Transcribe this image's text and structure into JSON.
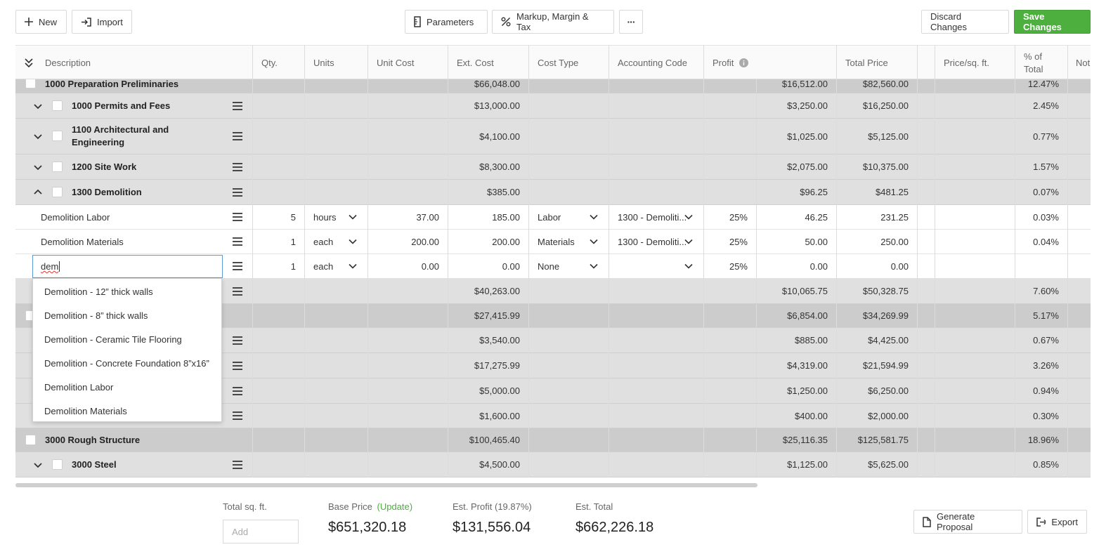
{
  "toolbar": {
    "new_label": "New",
    "import_label": "Import",
    "parameters_label": "Parameters",
    "markup_label": "Markup, Margin & Tax",
    "more_label": "···",
    "discard_label": "Discard Changes",
    "save_label": "Save Changes"
  },
  "columns": {
    "description": "Description",
    "qty": "Qty.",
    "units": "Units",
    "unit_cost": "Unit Cost",
    "ext_cost": "Ext. Cost",
    "cost_type": "Cost Type",
    "accounting_code": "Accounting Code",
    "profit": "Profit",
    "total_price": "Total Price",
    "price_sqft": "Price/sq. ft.",
    "pct_total_1": "% of",
    "pct_total_2": "Total",
    "notes": "Not"
  },
  "rows": [
    {
      "type": "section",
      "name": "1000 Preparation Preliminaries",
      "ext_cost": "$66,048.00",
      "profit": "$16,512.00",
      "total": "$82,560.00",
      "pct": "12.47%"
    },
    {
      "type": "group",
      "name": "1000 Permits and Fees",
      "ext_cost": "$13,000.00",
      "profit": "$3,250.00",
      "total": "$16,250.00",
      "pct": "2.45%"
    },
    {
      "type": "group",
      "name_line1": "1100 Architectural and",
      "name_line2": "Engineering",
      "ext_cost": "$4,100.00",
      "profit": "$1,025.00",
      "total": "$5,125.00",
      "pct": "0.77%"
    },
    {
      "type": "group",
      "name": "1200 Site Work",
      "ext_cost": "$8,300.00",
      "profit": "$2,075.00",
      "total": "$10,375.00",
      "pct": "1.57%"
    },
    {
      "type": "group",
      "name": "1300 Demolition",
      "ext_cost": "$385.00",
      "profit": "$96.25",
      "total": "$481.25",
      "pct": "0.07%"
    },
    {
      "type": "item",
      "name": "Demolition Labor",
      "qty": "5",
      "units": "hours",
      "unit_cost": "37.00",
      "ext_cost": "185.00",
      "cost_type": "Labor",
      "acct": "1300 - Demoliti...",
      "markup": "25%",
      "profit": "46.25",
      "total": "231.25",
      "pct": "0.03%"
    },
    {
      "type": "item",
      "name": "Demolition Materials",
      "qty": "1",
      "units": "each",
      "unit_cost": "200.00",
      "ext_cost": "200.00",
      "cost_type": "Materials",
      "acct": "1300 - Demoliti...",
      "markup": "25%",
      "profit": "50.00",
      "total": "250.00",
      "pct": "0.04%"
    },
    {
      "type": "item-edit",
      "input_value": "dem",
      "qty": "1",
      "units": "each",
      "unit_cost": "0.00",
      "ext_cost": "0.00",
      "cost_type": "None",
      "acct": "",
      "markup": "25%",
      "profit": "0.00",
      "total": "0.00",
      "pct": ""
    },
    {
      "type": "group",
      "ext_cost": "$40,263.00",
      "profit": "$10,065.75",
      "total": "$50,328.75",
      "pct": "7.60%"
    },
    {
      "type": "section",
      "ext_cost": "$27,415.99",
      "profit": "$6,854.00",
      "total": "$34,269.99",
      "pct": "5.17%"
    },
    {
      "type": "group",
      "ext_cost": "$3,540.00",
      "profit": "$885.00",
      "total": "$4,425.00",
      "pct": "0.67%"
    },
    {
      "type": "group",
      "ext_cost": "$17,275.99",
      "profit": "$4,319.00",
      "total": "$21,594.99",
      "pct": "3.26%"
    },
    {
      "type": "group",
      "ext_cost": "$5,000.00",
      "profit": "$1,250.00",
      "total": "$6,250.00",
      "pct": "0.94%"
    },
    {
      "type": "group",
      "ext_cost": "$1,600.00",
      "profit": "$400.00",
      "total": "$2,000.00",
      "pct": "0.30%"
    },
    {
      "type": "section",
      "name": "3000 Rough Structure",
      "ext_cost": "$100,465.40",
      "profit": "$25,116.35",
      "total": "$125,581.75",
      "pct": "18.96%"
    },
    {
      "type": "group",
      "name": "3000 Steel",
      "ext_cost": "$4,500.00",
      "profit": "$1,125.00",
      "total": "$5,625.00",
      "pct": "0.85%"
    }
  ],
  "autocomplete": [
    "Demolition - 12” thick walls",
    "Demolition - 8” thick walls",
    "Demolition - Ceramic Tile Flooring",
    "Demolition - Concrete Foundation 8”x16”",
    "Demolition Labor",
    "Demolition Materials"
  ],
  "footer": {
    "sqft_label": "Total sq. ft.",
    "sqft_placeholder": "Add",
    "base_price_label": "Base Price",
    "update_label": "(Update)",
    "base_price_value": "$651,320.18",
    "est_profit_label": "Est. Profit",
    "est_profit_pct": "(19.87%)",
    "est_profit_value": "$131,556.04",
    "est_total_label": "Est. Total",
    "est_total_value": "$662,226.18",
    "generate_label": "Generate Proposal",
    "export_label": "Export"
  },
  "colors": {
    "accent_green": "#4caf3e",
    "update_green": "#4caf3e",
    "input_focus": "#5b9bd5"
  }
}
